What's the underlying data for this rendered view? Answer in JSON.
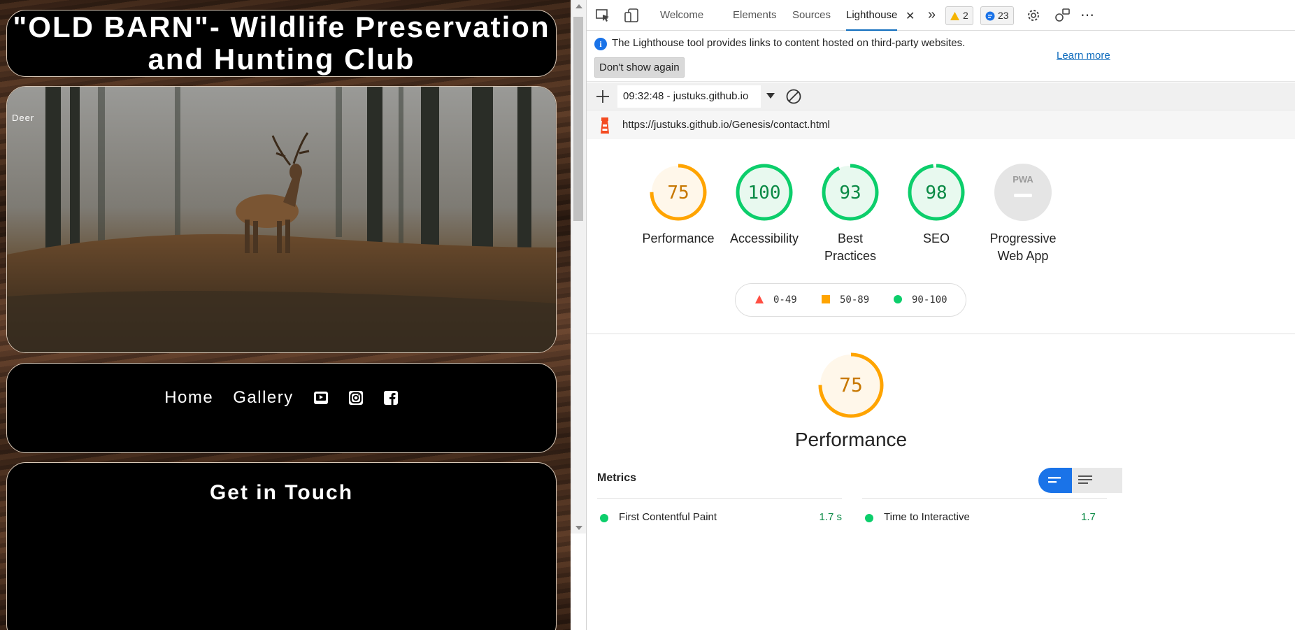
{
  "site": {
    "title_line1": "\"OLD BARN\"- Wildlife Preservation",
    "title_line2": "and Hunting Club",
    "hero_caption": "Deer",
    "nav": [
      {
        "label": "Home"
      },
      {
        "label": "Gallery"
      }
    ],
    "social_icons": [
      "youtube-icon",
      "instagram-icon",
      "facebook-icon"
    ],
    "contact_title": "Get in Touch"
  },
  "devtools": {
    "tabs": [
      "Welcome",
      "Elements",
      "Sources",
      "Lighthouse"
    ],
    "active_tab": "Lighthouse",
    "warnings_count": "2",
    "messages_count": "23",
    "info_text": "The Lighthouse tool provides links to content hosted on third-party websites.",
    "learn_more": "Learn more",
    "dont_show_again": "Don't show again",
    "report_select": "09:32:48 - justuks.github.io",
    "report_url": "https://justuks.github.io/Genesis/contact.html",
    "colors": {
      "pass": "#0cce6b",
      "average": "#ffa400",
      "fail": "#ff4e42",
      "accent": "#1a73e8"
    }
  },
  "lighthouse": {
    "categories": [
      {
        "name": "Performance",
        "score": 75,
        "rating": "average"
      },
      {
        "name": "Accessibility",
        "score": 100,
        "rating": "pass"
      },
      {
        "name": "Best Practices",
        "score": 93,
        "rating": "pass"
      },
      {
        "name": "SEO",
        "score": 98,
        "rating": "pass"
      },
      {
        "name": "Progressive Web App",
        "score": null,
        "rating": "na",
        "badge": "PWA"
      }
    ],
    "legend": [
      {
        "range": "0-49",
        "shape": "triangle"
      },
      {
        "range": "50-89",
        "shape": "square"
      },
      {
        "range": "90-100",
        "shape": "circle"
      }
    ],
    "focus_category": {
      "name": "Performance",
      "score": 75
    },
    "metrics_title": "Metrics",
    "metrics": [
      {
        "name": "First Contentful Paint",
        "value": "1.7 s"
      },
      {
        "name": "Time to Interactive",
        "value": "1.7"
      }
    ]
  }
}
